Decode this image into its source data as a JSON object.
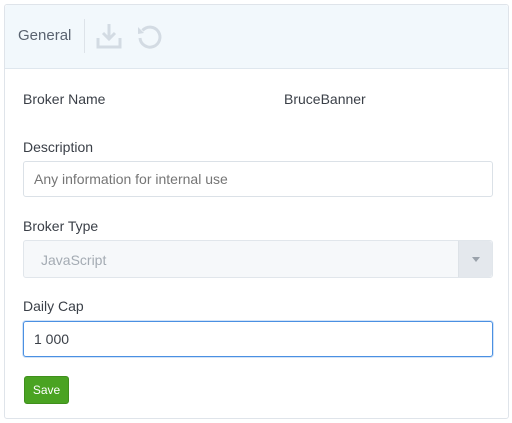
{
  "toolbar": {
    "title": "General",
    "save_icon": "download-icon",
    "reset_icon": "undo-icon"
  },
  "form": {
    "broker_name": {
      "label": "Broker Name",
      "value": "BruceBanner"
    },
    "description": {
      "label": "Description",
      "placeholder": "Any information for internal use"
    },
    "broker_type": {
      "label": "Broker Type",
      "selected": "JavaScript"
    },
    "daily_cap": {
      "label": "Daily Cap",
      "value": "1 000"
    }
  },
  "actions": {
    "save_label": "Save"
  },
  "colors": {
    "accent_green": "#4aa322",
    "focus_blue": "#4a90e2",
    "toolbar_bg": "#f2f8fc"
  }
}
